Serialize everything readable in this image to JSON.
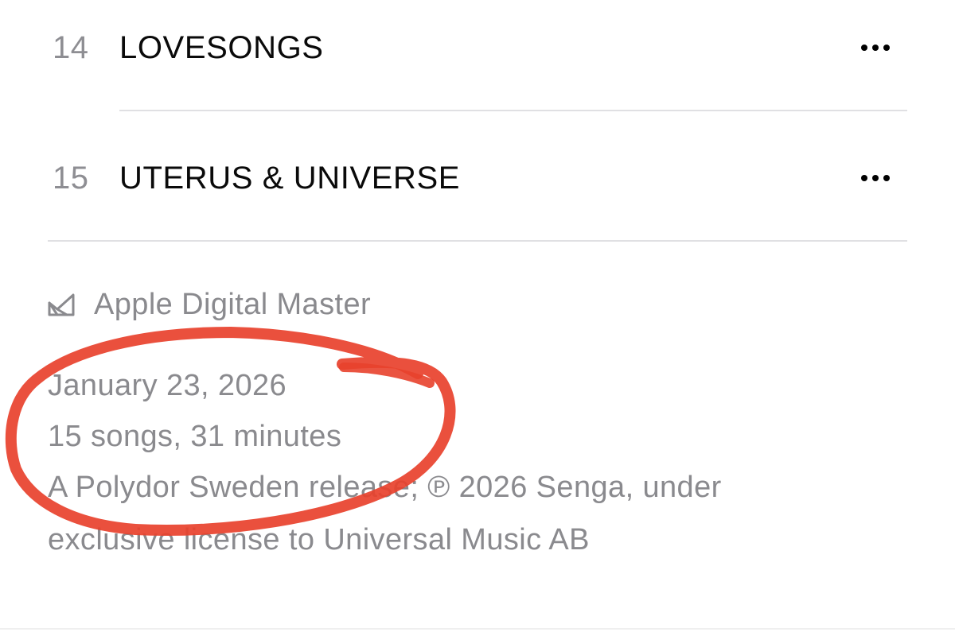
{
  "tracks": [
    {
      "number": "14",
      "title": "LOVESONGS"
    },
    {
      "number": "15",
      "title": "UTERUS & UNIVERSE"
    }
  ],
  "album_info": {
    "badge_icon": "apple-digital-master-icon",
    "badge_label": "Apple Digital Master",
    "release_date": "January 23, 2026",
    "song_summary": "15 songs, 31 minutes",
    "copyright_line1": "A Polydor Sweden release; ℗ 2026 Senga, under",
    "copyright_line2": "exclusive license to Universal Music AB"
  },
  "colors": {
    "secondary_text": "#8a8a8e",
    "annotation_circle": "#e8412c"
  }
}
